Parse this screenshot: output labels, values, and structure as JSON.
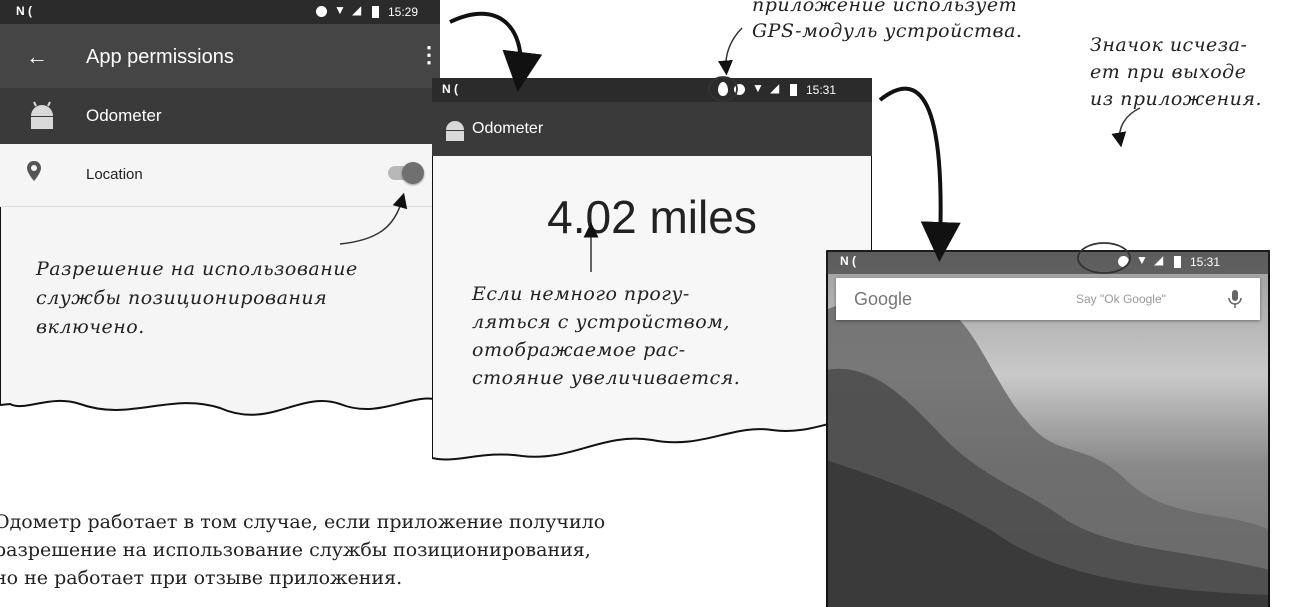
{
  "screen1": {
    "status": {
      "left_icons": "N (",
      "time": "15:29"
    },
    "toolbar": {
      "title": "App permissions"
    },
    "app": {
      "name": "Odometer"
    },
    "permission": {
      "label": "Location",
      "enabled": true
    }
  },
  "screen2": {
    "status": {
      "left_icons": "N (",
      "time": "15:31"
    },
    "app": {
      "name": "Odometer"
    },
    "distance": "4.02 miles"
  },
  "screen3": {
    "status": {
      "left_icons": "N (",
      "time": "15:31"
    },
    "search": {
      "logo": "Google",
      "hint": "Say \"Ok Google\""
    }
  },
  "notes": {
    "gps_line1": "приложение использует",
    "gps_line2": "GPS-модуль устройства.",
    "icon_line1": "Значок исчеза-",
    "icon_line2": "ет при выходе",
    "icon_line3": "из приложения.",
    "perm_line1": "Разрешение на использование",
    "perm_line2": "службы позиционирования",
    "perm_line3": "включено.",
    "walk_line1": "Если немного прогу-",
    "walk_line2": "ляться с устройством,",
    "walk_line3": "отображаемое рас-",
    "walk_line4": "стояние увеличивается."
  },
  "caption": {
    "line1": "Одометр работает в том случае, если приложение получило",
    "line2": "разрешение на использование службы позиционирования,",
    "line3": "но не работает при отзыве приложения."
  },
  "colors": {
    "status_bar": "#2b2b2b",
    "toolbar": "#444444",
    "app_bar": "#3a3a3a",
    "accent": "#d9d9d9"
  }
}
